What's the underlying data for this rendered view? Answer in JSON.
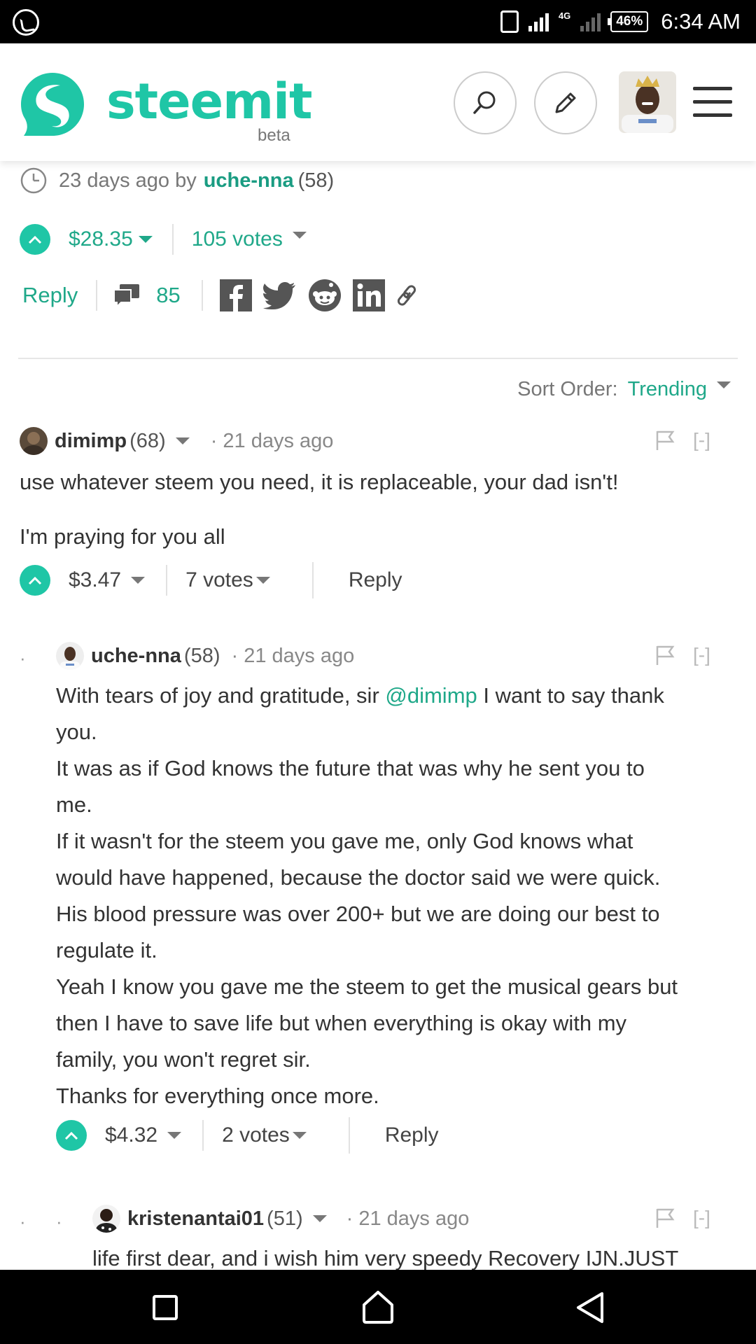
{
  "status_bar": {
    "network": "4G",
    "battery": "46%",
    "time": "6:34 AM"
  },
  "header": {
    "logo_text": "steemit",
    "logo_sub": "beta",
    "icons": [
      "search-icon",
      "pencil-icon",
      "avatar",
      "hamburger-menu-icon"
    ]
  },
  "post": {
    "age": "23 days ago by",
    "author": "uche-nna",
    "reputation": "(58)",
    "payout": "$28.35",
    "votes": "105 votes",
    "reply_label": "Reply",
    "comment_count": "85",
    "share_icons": [
      "facebook-icon",
      "twitter-icon",
      "reddit-icon",
      "linkedin-icon",
      "link-icon"
    ]
  },
  "sort": {
    "label": "Sort Order:",
    "value": "Trending"
  },
  "comments": [
    {
      "author": "dimimp",
      "reputation": "(68)",
      "age": "· 21 days ago",
      "collapse": "[-]",
      "lines": [
        "use whatever steem you need, it is replaceable, your dad isn't!",
        "I'm praying for you all"
      ],
      "payout": "$3.47",
      "votes": "7 votes",
      "reply_label": "Reply"
    },
    {
      "author": "uche-nna",
      "reputation": "(58)",
      "age": "· 21 days ago",
      "collapse": "[-]",
      "intro": "With tears of joy and gratitude, sir",
      "mention": "@dimimp",
      "intro_rest": "I want to say thank",
      "lines": [
        "you.",
        "It was as if God knows the future that was why he sent you to",
        "me.",
        "If it wasn't for the steem you gave me, only God knows what",
        "would have happened, because the doctor said we were quick.",
        "His blood pressure was over 200+ but we are doing our best to",
        "regulate it.",
        "Yeah I know you gave me the steem to get the musical gears but",
        "then I have to save life but when everything is okay with my",
        "family, you won't regret sir.",
        "Thanks for everything once more."
      ],
      "payout": "$4.32",
      "votes": "2 votes",
      "reply_label": "Reply"
    },
    {
      "author": "kristenantai01",
      "reputation": "(51)",
      "age": "· 21 days ago",
      "collapse": "[-]",
      "lines": [
        "life first dear, and i wish him very speedy Recovery IJN.JUST"
      ]
    }
  ],
  "colors": {
    "accent": "#1fc6a6",
    "accent_text": "#1fa889"
  }
}
